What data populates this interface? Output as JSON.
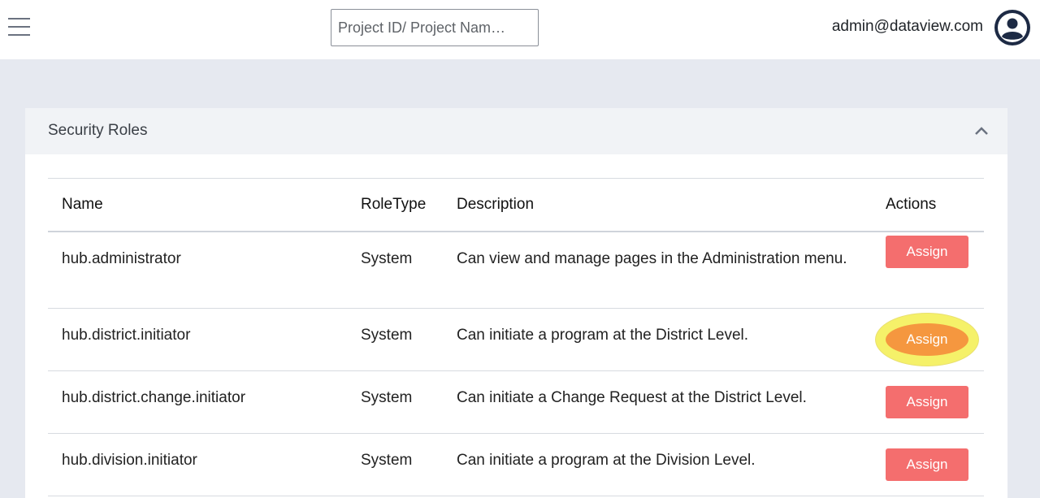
{
  "header": {
    "search_placeholder": "Project ID/ Project Nam…",
    "user_email": "admin@dataview.com"
  },
  "panel": {
    "title": "Security Roles"
  },
  "table": {
    "columns": [
      "Name",
      "RoleType",
      "Description",
      "Actions"
    ],
    "rows": [
      {
        "name": "hub.administrator",
        "role_type": "System",
        "description": "Can view and manage pages in the Administration menu.",
        "action": "Assign"
      },
      {
        "name": "hub.district.initiator",
        "role_type": "System",
        "description": "Can initiate a program at the District Level.",
        "action": "Assign"
      },
      {
        "name": "hub.district.change.initiator",
        "role_type": "System",
        "description": "Can initiate a Change Request at the District Level.",
        "action": "Assign"
      },
      {
        "name": "hub.division.initiator",
        "role_type": "System",
        "description": "Can initiate a program at the Division Level.",
        "action": "Assign"
      }
    ]
  },
  "colors": {
    "assign_button": "#f46e6e",
    "assign_button_highlighted": "#f5973f",
    "highlight_ring": "#ffff64",
    "page_background": "#e6e9f0"
  }
}
